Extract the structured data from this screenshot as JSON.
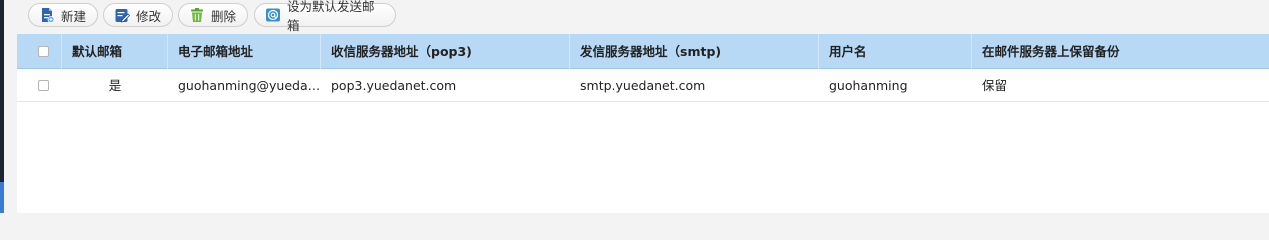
{
  "toolbar": {
    "buttons": [
      {
        "label": "新建",
        "icon": "new-document-icon"
      },
      {
        "label": "修改",
        "icon": "edit-icon"
      },
      {
        "label": "删除",
        "icon": "trash-icon"
      },
      {
        "label": "设为默认发送邮箱",
        "icon": "email-at-icon"
      }
    ]
  },
  "table": {
    "columns": [
      "默认邮箱",
      "电子邮箱地址",
      "收信服务器地址（pop3)",
      "发信服务器地址（smtp)",
      "用户名",
      "在邮件服务器上保留备份"
    ],
    "rows": [
      {
        "checked": false,
        "default": "是",
        "email": "guohanming@yuedan...",
        "pop3": "pop3.yuedanet.com",
        "smtp": "smtp.yuedanet.com",
        "username": "guohanming",
        "keep_backup": "保留"
      }
    ]
  },
  "colors": {
    "header_bg": "#b8d9f6",
    "accent": "#3a7bd5"
  }
}
